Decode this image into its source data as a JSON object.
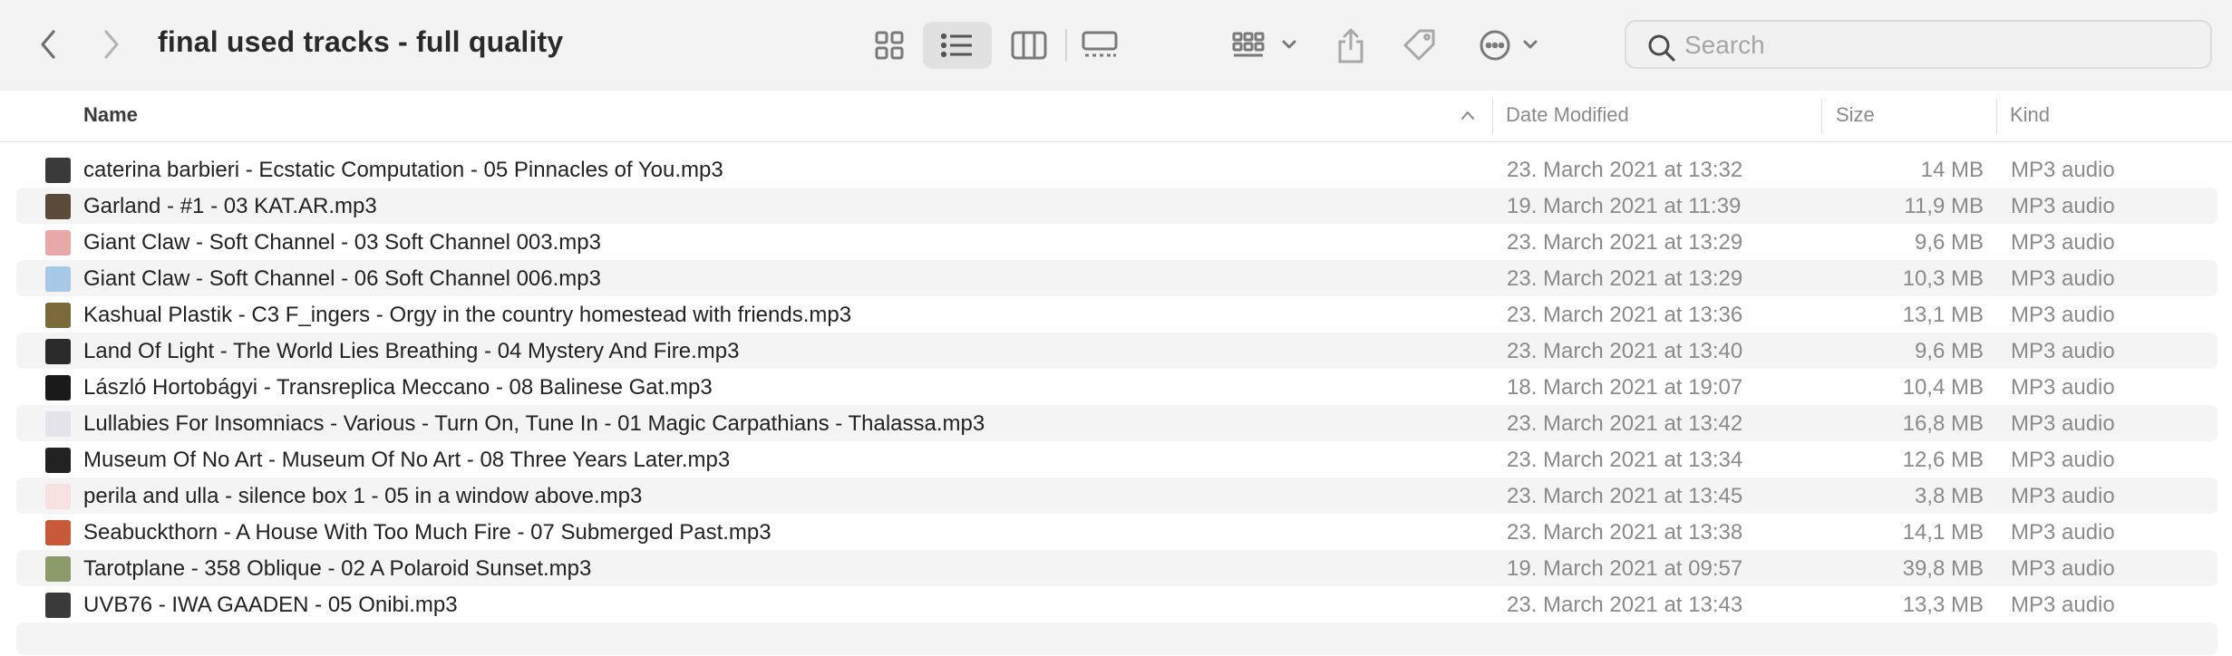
{
  "window": {
    "title": "final used tracks - full quality"
  },
  "toolbar": {
    "back_icon": "chevron-left-icon",
    "forward_icon": "chevron-right-icon",
    "view_modes": [
      "icon-view-icon",
      "list-view-icon",
      "column-view-icon",
      "gallery-view-icon"
    ],
    "active_view": "list-view-icon",
    "group_icon": "group-by-icon",
    "share_icon": "share-icon",
    "tag_icon": "tag-icon",
    "more_icon": "ellipsis-circle-icon",
    "search_placeholder": "Search"
  },
  "columns": {
    "name": "Name",
    "date": "Date Modified",
    "size": "Size",
    "kind": "Kind"
  },
  "files": [
    {
      "name": "caterina barbieri - Ecstatic Computation - 05 Pinnacles of You.mp3",
      "date": "23. March 2021 at 13:32",
      "size": "14 MB",
      "kind": "MP3 audio",
      "thumb_color": "#3a3a3a"
    },
    {
      "name": "Garland - #1 - 03 KAT.AR.mp3",
      "date": "19. March 2021 at 11:39",
      "size": "11,9 MB",
      "kind": "MP3 audio",
      "thumb_color": "#5a4a3a"
    },
    {
      "name": "Giant Claw - Soft Channel - 03 Soft Channel 003.mp3",
      "date": "23. March 2021 at 13:29",
      "size": "9,6 MB",
      "kind": "MP3 audio",
      "thumb_color": "#e8a8a8"
    },
    {
      "name": "Giant Claw - Soft Channel - 06 Soft Channel 006.mp3",
      "date": "23. March 2021 at 13:29",
      "size": "10,3 MB",
      "kind": "MP3 audio",
      "thumb_color": "#a8c8e8"
    },
    {
      "name": "Kashual Plastik - C3 F_ingers - Orgy in the country homestead with friends.mp3",
      "date": "23. March 2021 at 13:36",
      "size": "13,1 MB",
      "kind": "MP3 audio",
      "thumb_color": "#7a6a3a"
    },
    {
      "name": "Land Of Light - The World Lies Breathing - 04 Mystery And Fire.mp3",
      "date": "23. March 2021 at 13:40",
      "size": "9,6 MB",
      "kind": "MP3 audio",
      "thumb_color": "#2a2a2a"
    },
    {
      "name": "László Hortobágyi - Transreplica Meccano - 08 Balinese Gat.mp3",
      "date": "18. March 2021 at 19:07",
      "size": "10,4 MB",
      "kind": "MP3 audio",
      "thumb_color": "#1a1a1a"
    },
    {
      "name": "Lullabies For Insomniacs - Various - Turn On, Tune In - 01 Magic Carpathians - Thalassa.mp3",
      "date": "23. March 2021 at 13:42",
      "size": "16,8 MB",
      "kind": "MP3 audio",
      "thumb_color": "#e4e4ea"
    },
    {
      "name": "Museum Of No Art - Museum Of No Art - 08 Three Years Later.mp3",
      "date": "23. March 2021 at 13:34",
      "size": "12,6 MB",
      "kind": "MP3 audio",
      "thumb_color": "#222222"
    },
    {
      "name": "perila and ulla - silence box 1 - 05 in a window above.mp3",
      "date": "23. March 2021 at 13:45",
      "size": "3,8 MB",
      "kind": "MP3 audio",
      "thumb_color": "#f6e0e0"
    },
    {
      "name": "Seabuckthorn - A House With Too Much Fire - 07 Submerged Past.mp3",
      "date": "23. March 2021 at 13:38",
      "size": "14,1 MB",
      "kind": "MP3 audio",
      "thumb_color": "#c85a3a"
    },
    {
      "name": "Tarotplane - 358 Oblique - 02 A Polaroid Sunset.mp3",
      "date": "19. March 2021 at 09:57",
      "size": "39,8 MB",
      "kind": "MP3 audio",
      "thumb_color": "#8a9a6a"
    },
    {
      "name": "UVB76 - IWA GAADEN - 05 Onibi.mp3",
      "date": "23. March 2021 at 13:43",
      "size": "13,3 MB",
      "kind": "MP3 audio",
      "thumb_color": "#3a3a3a"
    }
  ]
}
